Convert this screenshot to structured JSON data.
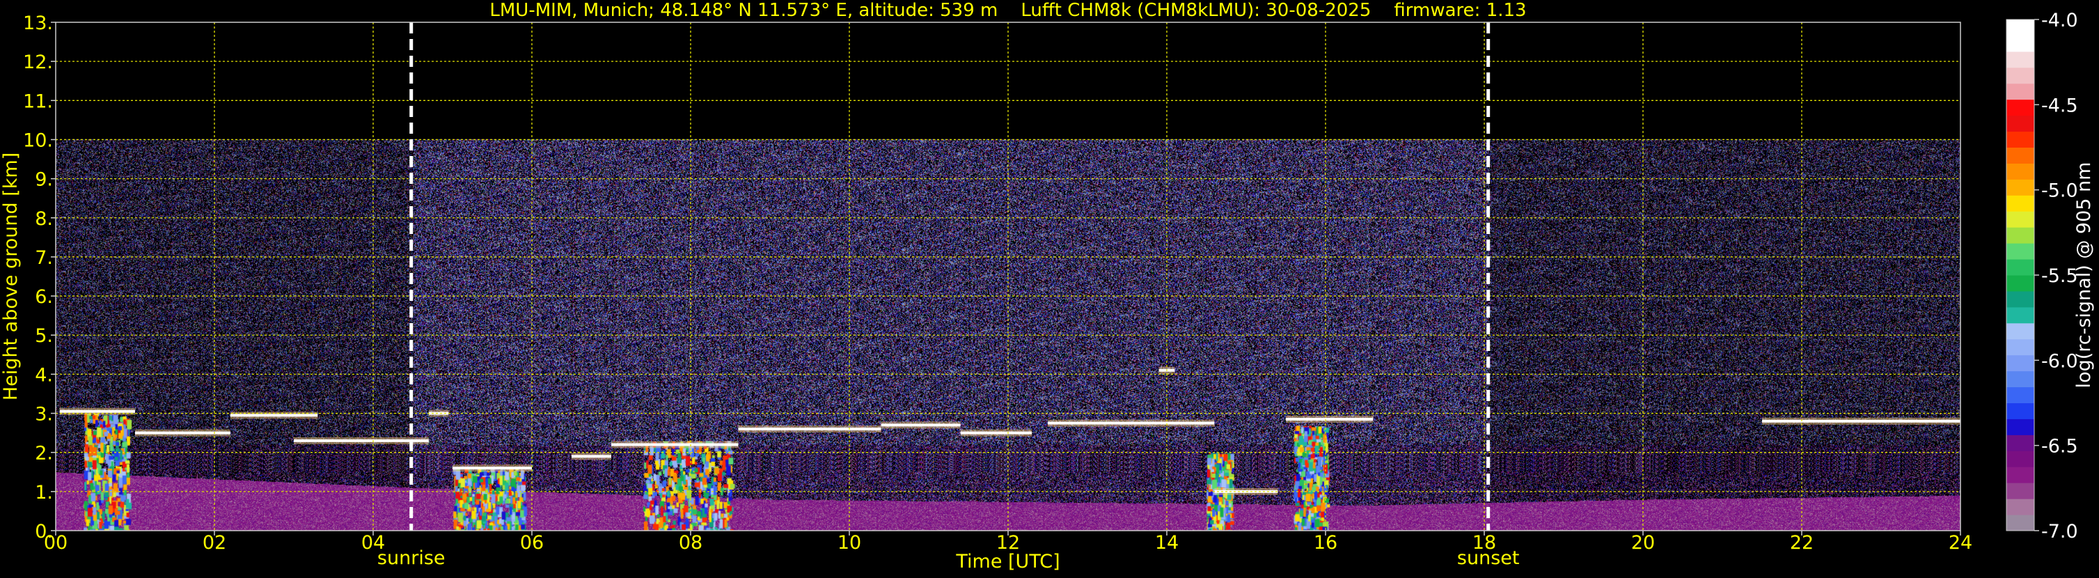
{
  "chart_data": {
    "type": "heatmap",
    "title": "LMU-MIM, Munich; 48.148° N 11.573° E, altitude: 539 m    Lufft CHM8k (CHM8kLMU): 30-08-2025    firmware: 1.13",
    "xlabel": "Time [UTC]",
    "ylabel": "Height above ground [km]",
    "xlim": [
      0,
      24
    ],
    "ylim": [
      0,
      13
    ],
    "x_ticks": [
      "00",
      "02",
      "04",
      "06",
      "08",
      "10",
      "12",
      "14",
      "16",
      "18",
      "20",
      "22",
      "24"
    ],
    "x_tick_values": [
      0,
      2,
      4,
      6,
      8,
      10,
      12,
      14,
      16,
      18,
      20,
      22,
      24
    ],
    "y_ticks": [
      "0.",
      "1.",
      "2.",
      "3.",
      "4.",
      "5.",
      "6.",
      "7.",
      "8.",
      "9.",
      "10.",
      "11.",
      "12.",
      "13."
    ],
    "y_tick_values": [
      0,
      1,
      2,
      3,
      4,
      5,
      6,
      7,
      8,
      9,
      10,
      11,
      12,
      13
    ],
    "grid": true,
    "data_top_km": 10,
    "markers": [
      {
        "label": "sunrise",
        "time_h": 4.48
      },
      {
        "label": "sunset",
        "time_h": 18.05
      }
    ],
    "colorbar": {
      "label": "log(rc-signal) @ 905 nm",
      "min": -7.0,
      "max": -4.0,
      "tick_values": [
        -4.0,
        -4.5,
        -5.0,
        -5.5,
        -6.0,
        -6.5,
        -7.0
      ],
      "tick_labels": [
        "-4.0",
        "-4.5",
        "-5.0",
        "-5.5",
        "-6.0",
        "-6.5",
        "-7.0"
      ],
      "colors_low_to_high": [
        "#9a8aa0",
        "#a8769f",
        "#94418f",
        "#8a1a87",
        "#7a0f82",
        "#6b0f8a",
        "#1a0fd0",
        "#1e3ef0",
        "#3a66f5",
        "#5a86f2",
        "#7c9cf5",
        "#95b2f7",
        "#a8c3f7",
        "#1fb8a0",
        "#0fa080",
        "#14b04a",
        "#28c060",
        "#5ad872",
        "#a0e040",
        "#e0ee30",
        "#ffe000",
        "#ffb000",
        "#ff9000",
        "#ff6a00",
        "#ff3000",
        "#ee1010",
        "#ff0a0a",
        "#f0a0a8",
        "#f2c0c4",
        "#f5dadc",
        "#ffffff",
        "#ffffff"
      ]
    },
    "cloud_base_layers_km": [
      {
        "t_start": 0.05,
        "t_end": 1.0,
        "height": 3.05
      },
      {
        "t_start": 1.0,
        "t_end": 2.2,
        "height": 2.5
      },
      {
        "t_start": 2.2,
        "t_end": 3.3,
        "height": 2.95
      },
      {
        "t_start": 3.0,
        "t_end": 4.7,
        "height": 2.3
      },
      {
        "t_start": 4.7,
        "t_end": 4.95,
        "height": 3.0
      },
      {
        "t_start": 5.0,
        "t_end": 6.0,
        "height": 1.6
      },
      {
        "t_start": 6.5,
        "t_end": 7.0,
        "height": 1.9
      },
      {
        "t_start": 7.0,
        "t_end": 8.6,
        "height": 2.2
      },
      {
        "t_start": 8.6,
        "t_end": 10.4,
        "height": 2.6
      },
      {
        "t_start": 10.4,
        "t_end": 11.4,
        "height": 2.7
      },
      {
        "t_start": 11.4,
        "t_end": 12.3,
        "height": 2.5
      },
      {
        "t_start": 12.5,
        "t_end": 14.6,
        "height": 2.75
      },
      {
        "t_start": 14.6,
        "t_end": 15.4,
        "height": 1.0
      },
      {
        "t_start": 15.5,
        "t_end": 16.6,
        "height": 2.85
      },
      {
        "t_start": 13.9,
        "t_end": 14.1,
        "height": 4.1
      },
      {
        "t_start": 21.5,
        "t_end": 24.0,
        "height": 2.8
      }
    ],
    "precipitation_columns": [
      {
        "t_start": 0.35,
        "t_end": 0.9,
        "top_km": 3.0
      },
      {
        "t_start": 5.0,
        "t_end": 5.9,
        "top_km": 1.6
      },
      {
        "t_start": 7.4,
        "t_end": 8.5,
        "top_km": 2.3
      },
      {
        "t_start": 14.5,
        "t_end": 14.8,
        "top_km": 2.0
      },
      {
        "t_start": 15.6,
        "t_end": 16.0,
        "top_km": 2.7
      }
    ],
    "aerosol_layer_top_km": [
      {
        "time_h": 0,
        "height": 1.5
      },
      {
        "time_h": 4.5,
        "height": 1.1
      },
      {
        "time_h": 9,
        "height": 0.8
      },
      {
        "time_h": 16.5,
        "height": 0.65
      },
      {
        "time_h": 20,
        "height": 0.8
      },
      {
        "time_h": 24,
        "height": 0.9
      }
    ]
  }
}
